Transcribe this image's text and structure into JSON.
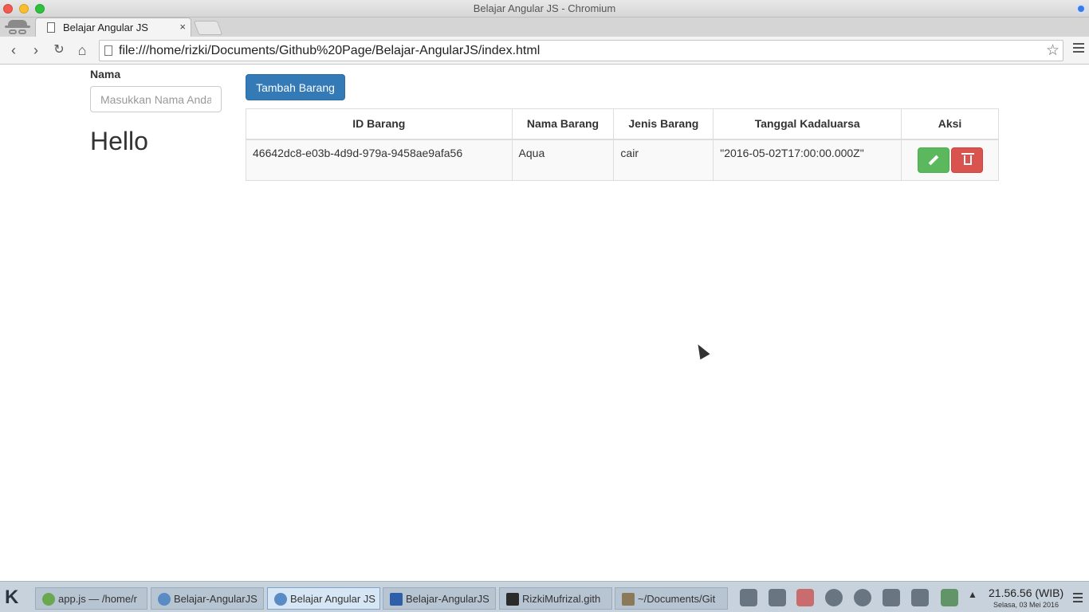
{
  "window": {
    "title": "Belajar Angular JS - Chromium"
  },
  "browser": {
    "tab_title": "Belajar Angular JS",
    "tab_close": "×",
    "url": "file:///home/rizki/Documents/Github%20Page/Belajar-AngularJS/index.html",
    "back": "‹",
    "forward": "›",
    "reload": "↻",
    "home": "⌂",
    "star": "☆"
  },
  "page": {
    "name_label": "Nama",
    "name_placeholder": "Masukkan Nama Anda",
    "greeting": "Hello",
    "add_button": "Tambah Barang",
    "table": {
      "headers": [
        "ID Barang",
        "Nama Barang",
        "Jenis Barang",
        "Tanggal Kadaluarsa",
        "Aksi"
      ],
      "rows": [
        {
          "id": "46642dc8-e03b-4d9d-979a-9458ae9afa56",
          "nama": "Aqua",
          "jenis": "cair",
          "tanggal": "\"2016-05-02T17:00:00.000Z\""
        }
      ]
    },
    "colors": {
      "primary": "#337ab7",
      "success": "#5cb85c",
      "danger": "#d9534f"
    }
  },
  "taskbar": {
    "tasks": [
      {
        "label": "app.js — /home/r"
      },
      {
        "label": "Belajar-AngularJS"
      },
      {
        "label": "Belajar Angular JS"
      },
      {
        "label": "Belajar-AngularJS"
      },
      {
        "label": "RizkiMufrizal.gith"
      },
      {
        "label": "~/Documents/Git"
      }
    ],
    "clock": "21.56.56 (WIB)",
    "date": "Selasa, 03 Mei 2016"
  }
}
